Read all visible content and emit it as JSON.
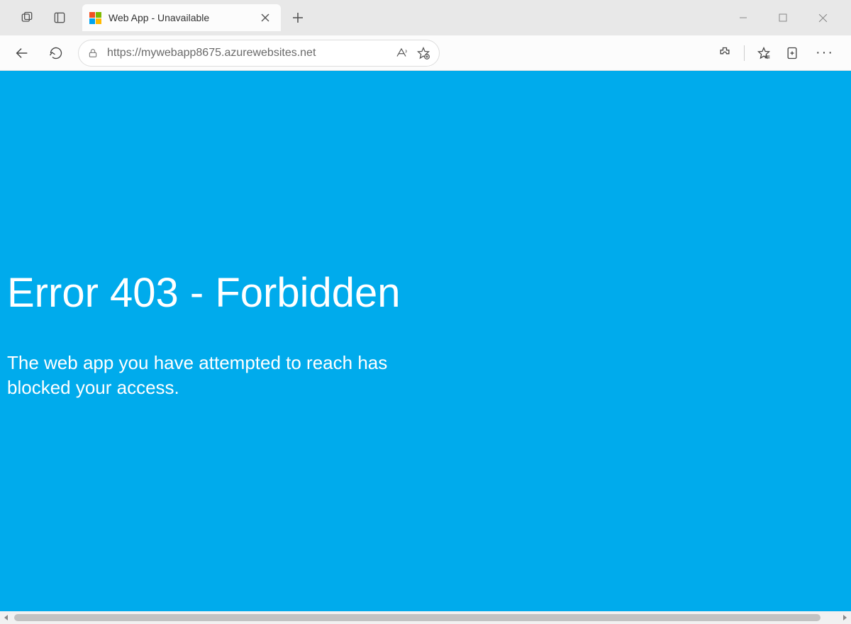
{
  "tab": {
    "title": "Web App - Unavailable"
  },
  "address": {
    "url": "https://mywebapp8675.azurewebsites.net"
  },
  "page": {
    "error_title": "Error 403 - Forbidden",
    "error_message": "The web app you have attempted to reach has blocked your access."
  },
  "colors": {
    "page_bg": "#00abec"
  }
}
